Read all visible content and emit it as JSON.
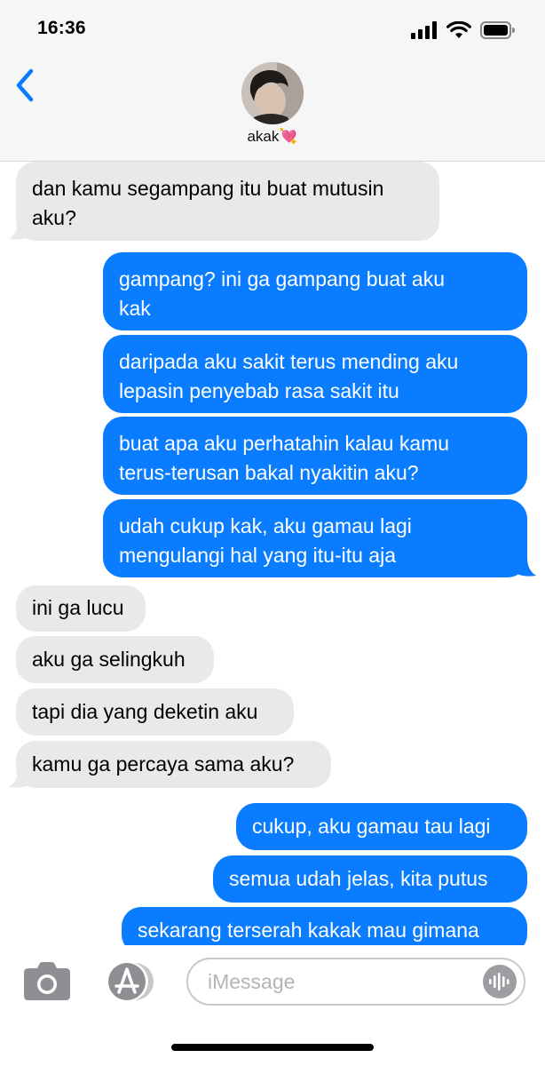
{
  "status_bar": {
    "time": "16:36"
  },
  "header": {
    "contact_name": "akak💘",
    "back_icon": "chevron-left-icon"
  },
  "messages": [
    {
      "direction": "in",
      "lines": [
        "dan kamu segampang itu buat mutusin",
        "aku?"
      ]
    },
    {
      "direction": "out",
      "lines": [
        "gampang? ini ga gampang buat aku",
        "kak"
      ]
    },
    {
      "direction": "out",
      "lines": [
        "daripada aku sakit terus mending aku",
        "lepasin penyebab rasa sakit itu"
      ]
    },
    {
      "direction": "out",
      "lines": [
        "buat apa aku perhatahin kalau kamu",
        "terus-terusan bakal nyakitin aku?"
      ]
    },
    {
      "direction": "out",
      "lines": [
        "udah cukup kak, aku gamau lagi",
        "mengulangi hal yang itu-itu aja"
      ]
    },
    {
      "direction": "in",
      "lines": [
        "ini ga lucu"
      ]
    },
    {
      "direction": "in",
      "lines": [
        "aku ga selingkuh"
      ]
    },
    {
      "direction": "in",
      "lines": [
        "tapi dia yang deketin aku"
      ]
    },
    {
      "direction": "in",
      "lines": [
        "kamu ga percaya sama aku?"
      ]
    },
    {
      "direction": "out",
      "lines": [
        "cukup, aku gamau tau lagi"
      ]
    },
    {
      "direction": "out",
      "lines": [
        "semua udah jelas, kita putus"
      ]
    },
    {
      "direction": "out",
      "lines": [
        "sekarang terserah kakak mau gimana"
      ]
    }
  ],
  "input_bar": {
    "placeholder": "iMessage"
  },
  "colors": {
    "outgoing_bubble": "#0a7cff",
    "incoming_bubble": "#e9e9eb",
    "accent": "#0a7cff"
  }
}
